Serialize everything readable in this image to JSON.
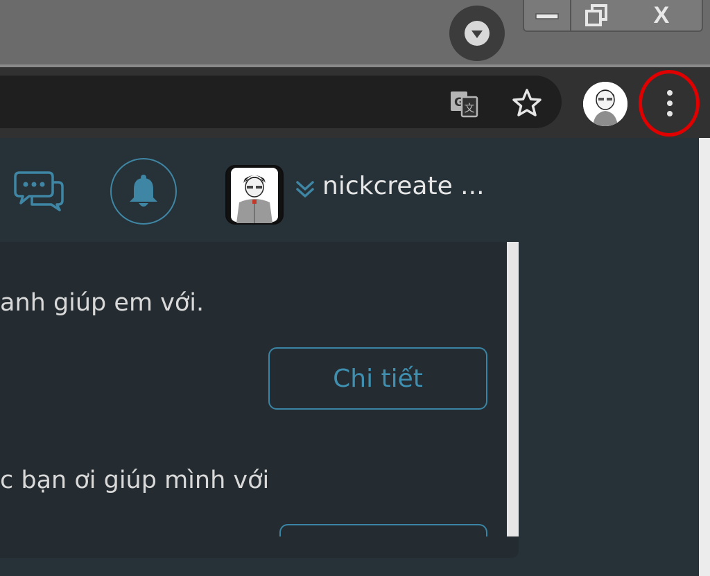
{
  "browser": {
    "window_controls": {
      "minimize": "minimize",
      "maximize": "restore",
      "close_label": "X"
    },
    "toolbar": {
      "translate_icon": "translate-icon",
      "bookmark_icon": "star-icon",
      "menu_icon": "vertical-dots-icon"
    },
    "highlight_color": "#e00000"
  },
  "header": {
    "chat_icon": "chat-bubbles-icon",
    "bell_icon": "bell-icon",
    "username": "nickcreate ...",
    "accent_color": "#3f86a5"
  },
  "panel": {
    "items": [
      {
        "text": "anh giúp em với.",
        "button_label": "Chi tiết"
      },
      {
        "text": "c bạn ơi giúp mình với"
      }
    ]
  }
}
